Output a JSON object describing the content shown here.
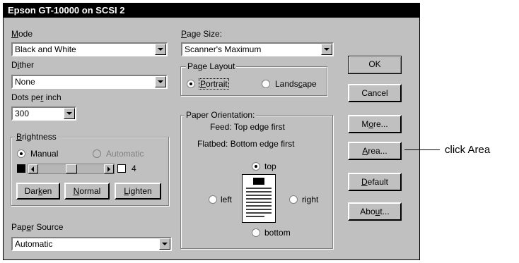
{
  "window": {
    "title": "Epson GT-10000 on SCSI 2"
  },
  "mode": {
    "label_pre": "",
    "label_u": "M",
    "label_post": "ode",
    "value": "Black and White"
  },
  "dither": {
    "label_pre": "D",
    "label_u": "i",
    "label_post": "ther",
    "value": "None"
  },
  "dpi": {
    "label_pre": "Dots pe",
    "label_u": "r",
    "label_post": " inch",
    "value": "300"
  },
  "brightness": {
    "legend_u": "B",
    "legend_post": "rightness",
    "manual_label": "Manual",
    "automatic_label": "Automatic",
    "value": "4",
    "level": 0.5,
    "darken_pre": "Dar",
    "darken_u": "k",
    "darken_post": "en",
    "normal_pre": "",
    "normal_u": "N",
    "normal_post": "ormal",
    "lighten_pre": "",
    "lighten_u": "L",
    "lighten_post": "ighten"
  },
  "paper_source": {
    "label_pre": "Pap",
    "label_u": "e",
    "label_post": "r Source",
    "value": "Automatic"
  },
  "page_size": {
    "label_pre": "",
    "label_u": "P",
    "label_post": "age Size:",
    "value": "Scanner's Maximum"
  },
  "page_layout": {
    "legend": "Page Layout",
    "portrait_pre": "",
    "portrait_u": "P",
    "portrait_post": "ortrait",
    "landscape_pre": "Lands",
    "landscape_u": "c",
    "landscape_post": "ape"
  },
  "paper_orientation": {
    "legend": "Paper Orientation:",
    "feed": "Feed: Top edge first",
    "flatbed": "Flatbed: Bottom edge first",
    "top": "top",
    "left": "left",
    "right": "right",
    "bottom": "bottom"
  },
  "buttons": {
    "ok": "OK",
    "cancel": "Cancel",
    "more_pre": "M",
    "more_u": "o",
    "more_post": "re...",
    "area_pre": "",
    "area_u": "A",
    "area_post": "rea...",
    "default_pre": "",
    "default_u": "D",
    "default_post": "efault",
    "about_pre": "Abo",
    "about_u": "u",
    "about_post": "t..."
  },
  "callout": {
    "text": "click Area"
  }
}
